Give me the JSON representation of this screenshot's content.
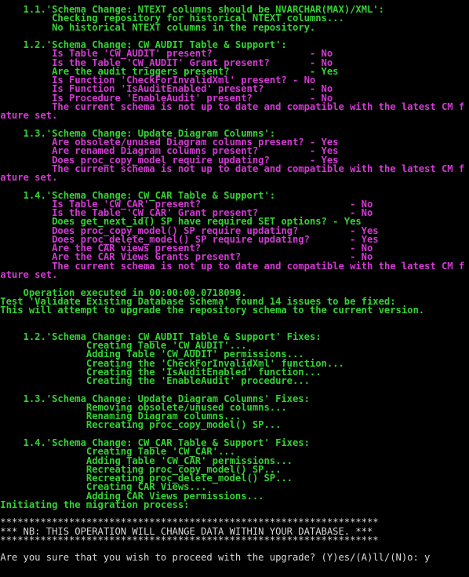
{
  "window": {
    "type": "console"
  },
  "colors": {
    "background": "#000000",
    "ok": "#33d233",
    "issue": "#d23ad2",
    "prompt": "#d8d8d8"
  },
  "lines": [
    {
      "text": "     1.1.'Schema Change: NTEXT columns should be NVARCHAR(MAX)/XML':",
      "c": "g"
    },
    {
      "text": "          Checking repository for historical NTEXT columns...",
      "c": "g"
    },
    {
      "text": "          No historical NTEXT columns in the repository.",
      "c": "g"
    },
    {
      "text": "",
      "c": "g"
    },
    {
      "text": "     1.2.'Schema Change: CW_AUDIT Table & Support':",
      "c": "g"
    },
    {
      "text": "          Is Table 'CW_AUDIT' present?                 - No",
      "c": "m"
    },
    {
      "text": "          Is the Table 'CW_AUDIT' Grant present?       - No",
      "c": "m"
    },
    {
      "text": "          Are the audit triggers present?              - Yes",
      "c": "g"
    },
    {
      "text": "          Is Function 'CheckForInvalidXml' present? - No",
      "c": "m"
    },
    {
      "text": "          Is Function 'IsAuditEnabled' present?        - No",
      "c": "m"
    },
    {
      "text": "          Is Procedure 'EnableAudit' present?          - No",
      "c": "m"
    },
    {
      "text": "          The current schema is not up to date and compatible with the latest CM f",
      "c": "m"
    },
    {
      "text": "eature set.",
      "c": "m"
    },
    {
      "text": "",
      "c": "g"
    },
    {
      "text": "     1.3.'Schema Change: Update Diagram Columns':",
      "c": "g"
    },
    {
      "text": "          Are obsolete/unused Diagram columns present? - Yes",
      "c": "m"
    },
    {
      "text": "          Are renamed Diagram columns present?         - Yes",
      "c": "m"
    },
    {
      "text": "          Does proc_copy_model require updating?       - Yes",
      "c": "m"
    },
    {
      "text": "          The current schema is not up to date and compatible with the latest CM f",
      "c": "m"
    },
    {
      "text": "eature set.",
      "c": "m"
    },
    {
      "text": "",
      "c": "g"
    },
    {
      "text": "     1.4.'Schema Change: CW_CAR Table & Support':",
      "c": "g"
    },
    {
      "text": "          Is Table 'CW_CAR' present?                          - No",
      "c": "m"
    },
    {
      "text": "          Is the Table 'CW_CAR' Grant present?                - No",
      "c": "m"
    },
    {
      "text": "          Does get_next_id() SP have required SET options? - Yes",
      "c": "g"
    },
    {
      "text": "          Does proc_copy_model() SP require updating?         - Yes",
      "c": "m"
    },
    {
      "text": "          Does proc_delete_model() SP require updating?       - Yes",
      "c": "m"
    },
    {
      "text": "          Are the CAR views present?                          - No",
      "c": "m"
    },
    {
      "text": "          Are the CAR Views Grants present?                   - No",
      "c": "m"
    },
    {
      "text": "          The current schema is not up to date and compatible with the latest CM f",
      "c": "m"
    },
    {
      "text": "eature set.",
      "c": "m"
    },
    {
      "text": "",
      "c": "g"
    },
    {
      "text": "     Operation executed in 00:00:00.0718090.",
      "c": "g"
    },
    {
      "text": " Test 'Validate Existing Database Schema' found 14 issues to be fixed:",
      "c": "g"
    },
    {
      "text": " This will attempt to upgrade the repository schema to the current version.",
      "c": "g"
    },
    {
      "text": "",
      "c": "g"
    },
    {
      "text": "",
      "c": "g"
    },
    {
      "text": "     1.2.'Schema Change: CW_AUDIT Table & Support' Fixes:",
      "c": "g"
    },
    {
      "text": "                Creating Table 'CW_AUDIT'...",
      "c": "g"
    },
    {
      "text": "                Adding Table 'CW_AUDIT' permissions...",
      "c": "g"
    },
    {
      "text": "                Creating the 'CheckForInvalidXml' function...",
      "c": "g"
    },
    {
      "text": "                Creating the 'IsAuditEnabled' function...",
      "c": "g"
    },
    {
      "text": "                Creating the 'EnableAudit' procedure...",
      "c": "g"
    },
    {
      "text": "",
      "c": "g"
    },
    {
      "text": "     1.3.'Schema Change: Update Diagram Columns' Fixes:",
      "c": "g"
    },
    {
      "text": "                Removing obsolete/unused columns...",
      "c": "g"
    },
    {
      "text": "                Renaming Diagram columns...",
      "c": "g"
    },
    {
      "text": "                Recreating proc_copy_model() SP...",
      "c": "g"
    },
    {
      "text": "",
      "c": "g"
    },
    {
      "text": "     1.4.'Schema Change: CW_CAR Table & Support' Fixes:",
      "c": "g"
    },
    {
      "text": "                Creating Table 'CW_CAR'...",
      "c": "g"
    },
    {
      "text": "                Adding Table 'CW_CAR' permissions...",
      "c": "g"
    },
    {
      "text": "                Recreating proc_copy_model() SP...",
      "c": "g"
    },
    {
      "text": "                Recreating proc_delete_model() SP...",
      "c": "g"
    },
    {
      "text": "                Creating CAR Views...",
      "c": "g"
    },
    {
      "text": "                Adding CAR Views permissions...",
      "c": "g"
    },
    {
      "text": " Initiating the migration process:",
      "c": "g"
    },
    {
      "text": "",
      "c": "g"
    },
    {
      "text": " ******************************************************************",
      "c": "w"
    },
    {
      "text": " *** NB: THIS OPERATION WILL CHANGE DATA WITHIN YOUR DATABASE. ***",
      "c": "w"
    },
    {
      "text": " ******************************************************************",
      "c": "w"
    },
    {
      "text": "",
      "c": "w"
    },
    {
      "text": " Are you sure that you wish to proceed with the upgrade? (Y)es/(A)ll/(N)o: y",
      "c": "w"
    }
  ],
  "prompt": {
    "question": "Are you sure that you wish to proceed with the upgrade? (Y)es/(A)ll/(N)o:",
    "input_value": "y"
  }
}
